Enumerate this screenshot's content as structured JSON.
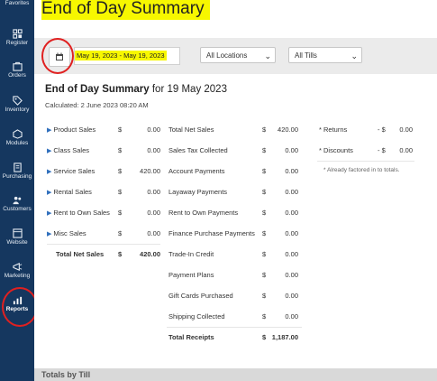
{
  "sidebar": {
    "items": [
      {
        "label": "Favorites",
        "icon": "star-icon"
      },
      {
        "label": "Register",
        "icon": "register-icon"
      },
      {
        "label": "Orders",
        "icon": "orders-icon"
      },
      {
        "label": "Inventory",
        "icon": "tag-icon"
      },
      {
        "label": "Modules",
        "icon": "modules-icon"
      },
      {
        "label": "Purchasing",
        "icon": "purchasing-icon"
      },
      {
        "label": "Customers",
        "icon": "customers-icon"
      },
      {
        "label": "Website",
        "icon": "website-icon"
      },
      {
        "label": "Marketing",
        "icon": "marketing-icon"
      },
      {
        "label": "Reports",
        "icon": "reports-icon"
      }
    ]
  },
  "header": {
    "title": "End of Day Summary"
  },
  "filters": {
    "date_range": "May 19, 2023 - May 19, 2023",
    "location": "All Locations",
    "tills": "All Tills"
  },
  "summary": {
    "title_bold": "End of Day Summary",
    "title_rest": " for 19 May 2023",
    "calculated": "Calculated: 2 June 2023 08:20 AM"
  },
  "sales": [
    {
      "label": "Product Sales",
      "currency": "$",
      "value": "0.00"
    },
    {
      "label": "Class Sales",
      "currency": "$",
      "value": "0.00"
    },
    {
      "label": "Service Sales",
      "currency": "$",
      "value": "420.00"
    },
    {
      "label": "Rental Sales",
      "currency": "$",
      "value": "0.00"
    },
    {
      "label": "Rent to Own Sales",
      "currency": "$",
      "value": "0.00"
    },
    {
      "label": "Misc Sales",
      "currency": "$",
      "value": "0.00"
    }
  ],
  "sales_total": {
    "label": "Total Net Sales",
    "currency": "$",
    "value": "420.00"
  },
  "receipts": [
    {
      "label": "Total Net Sales",
      "currency": "$",
      "value": "420.00"
    },
    {
      "label": "Sales Tax Collected",
      "currency": "$",
      "value": "0.00"
    },
    {
      "label": "Account Payments",
      "currency": "$",
      "value": "0.00"
    },
    {
      "label": "Layaway Payments",
      "currency": "$",
      "value": "0.00"
    },
    {
      "label": "Rent to Own Payments",
      "currency": "$",
      "value": "0.00"
    },
    {
      "label": "Finance Purchase Payments",
      "currency": "$",
      "value": "0.00"
    },
    {
      "label": "Trade-In Credit",
      "currency": "$",
      "value": "0.00"
    },
    {
      "label": "Payment Plans",
      "currency": "$",
      "value": "0.00"
    },
    {
      "label": "Gift Cards Purchased",
      "currency": "$",
      "value": "0.00"
    },
    {
      "label": "Shipping Collected",
      "currency": "$",
      "value": "0.00"
    }
  ],
  "receipts_total": {
    "label": "Total Receipts",
    "currency": "$",
    "value": "1,187.00"
  },
  "adjustments": [
    {
      "label": "* Returns",
      "currency": "- $",
      "value": "0.00"
    },
    {
      "label": "* Discounts",
      "currency": "- $",
      "value": "0.00"
    }
  ],
  "adjustments_note": "* Already factored in to totals.",
  "footer": {
    "partial_text": "Totals by Till"
  },
  "colors": {
    "sidebar": "#15375f",
    "highlight": "#f7f700",
    "annotation": "#e02020",
    "accent": "#2f6fbd"
  }
}
